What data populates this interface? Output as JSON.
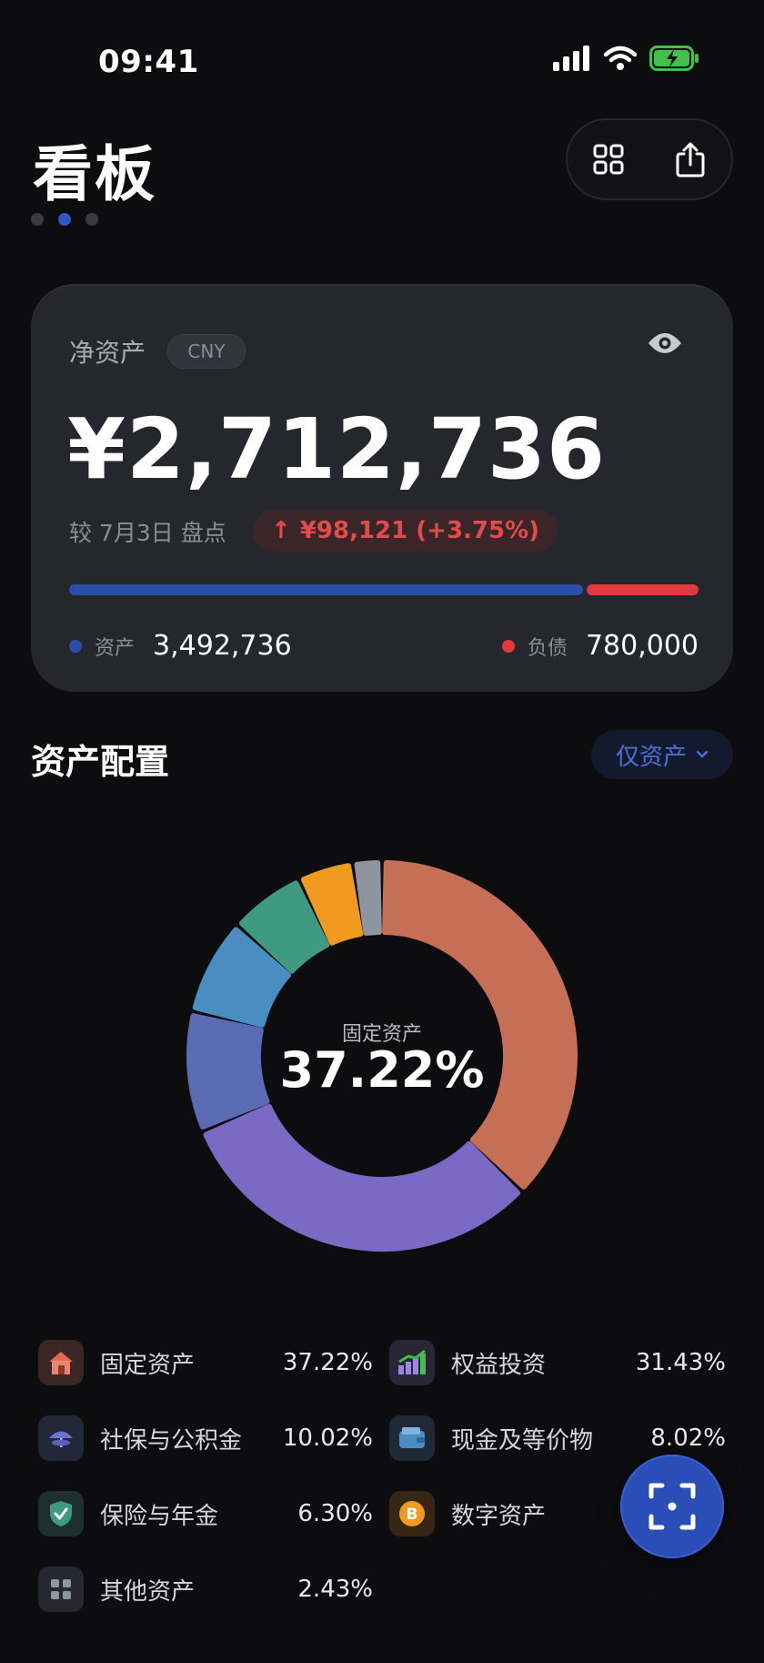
{
  "status_bar": {
    "time": "09:41"
  },
  "header": {
    "title": "看板",
    "page_indicator": {
      "count": 3,
      "active_index": 1
    }
  },
  "net_worth_card": {
    "label": "净资产",
    "currency": "CNY",
    "amount": "¥2,712,736",
    "compare_text": "较 7月3日 盘点",
    "change_arrow": "↑",
    "change_text": "¥98,121 (+3.75%)",
    "assets_label": "资产",
    "assets_value": "3,492,736",
    "liabilities_label": "负债",
    "liabilities_value": "780,000",
    "assets_fraction": 0.817,
    "colors": {
      "assets": "#2d4ea8",
      "liabilities": "#e0393e"
    }
  },
  "allocation": {
    "title": "资产配置",
    "filter_label": "仅资产",
    "center_label": "固定资产",
    "center_value": "37.22%"
  },
  "chart_data": {
    "type": "pie",
    "series": [
      {
        "name": "固定资产",
        "value": 37.22,
        "color": "#c46f56"
      },
      {
        "name": "权益投资",
        "value": 31.43,
        "color": "#7a6ac6"
      },
      {
        "name": "社保与公积金",
        "value": 10.02,
        "color": "#5b6cb5"
      },
      {
        "name": "现金及等价物",
        "value": 8.02,
        "color": "#4a8dc2"
      },
      {
        "name": "保险与年金",
        "value": 6.3,
        "color": "#3f9a82"
      },
      {
        "name": "数字资产",
        "value": 4.58,
        "color": "#f09a1f"
      },
      {
        "name": "其他资产",
        "value": 2.43,
        "color": "#8d959f"
      }
    ]
  },
  "legend": [
    {
      "name": "固定资产",
      "percent": "37.22%",
      "icon": "house-icon",
      "bg": "#3a2624"
    },
    {
      "name": "权益投资",
      "percent": "31.43%",
      "icon": "chart-icon",
      "bg": "#2a2638"
    },
    {
      "name": "社保与公积金",
      "percent": "10.02%",
      "icon": "umbrella-icon",
      "bg": "#232838"
    },
    {
      "name": "现金及等价物",
      "percent": "8.02%",
      "icon": "wallet-icon",
      "bg": "#1f2a36"
    },
    {
      "name": "保险与年金",
      "percent": "6.30%",
      "icon": "shield-check-icon",
      "bg": "#1d302b"
    },
    {
      "name": "数字资产",
      "percent": "",
      "icon": "bitcoin-icon",
      "bg": "#352714"
    },
    {
      "name": "其他资产",
      "percent": "2.43%",
      "icon": "grid-icon",
      "bg": "#262830"
    }
  ]
}
